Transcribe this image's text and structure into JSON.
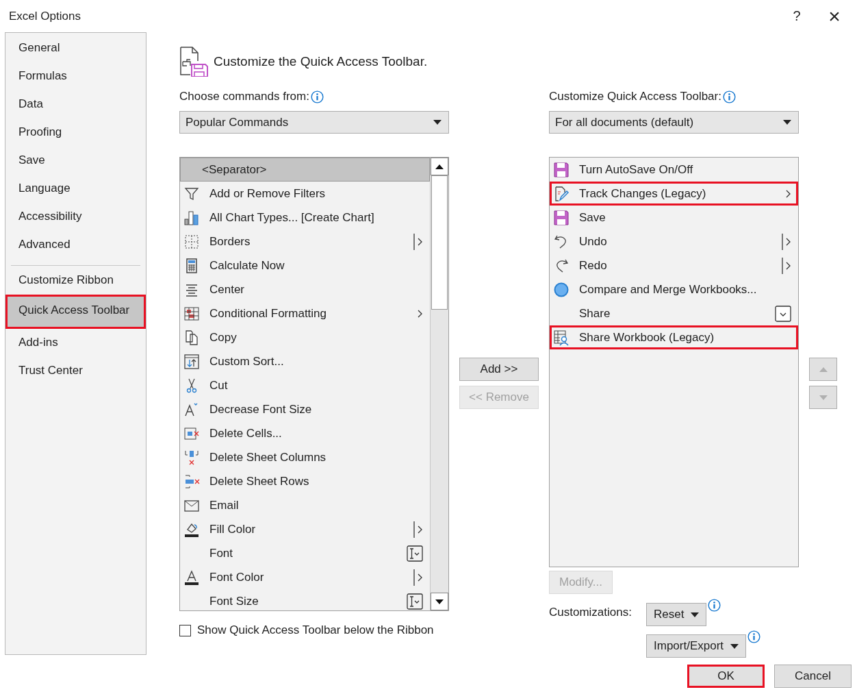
{
  "window": {
    "title": "Excel Options",
    "help": "?",
    "close": "×"
  },
  "sidebar": {
    "sections": [
      {
        "items": [
          {
            "label": "General",
            "selected": false,
            "highlighted": false
          },
          {
            "label": "Formulas",
            "selected": false,
            "highlighted": false
          },
          {
            "label": "Data",
            "selected": false,
            "highlighted": false
          },
          {
            "label": "Proofing",
            "selected": false,
            "highlighted": false
          },
          {
            "label": "Save",
            "selected": false,
            "highlighted": false
          },
          {
            "label": "Language",
            "selected": false,
            "highlighted": false
          },
          {
            "label": "Accessibility",
            "selected": false,
            "highlighted": false
          },
          {
            "label": "Advanced",
            "selected": false,
            "highlighted": false
          }
        ]
      },
      {
        "items": [
          {
            "label": "Customize Ribbon",
            "selected": false,
            "highlighted": false
          },
          {
            "label": "Quick Access Toolbar",
            "selected": true,
            "highlighted": true
          },
          {
            "label": "Add-ins",
            "selected": false,
            "highlighted": false
          },
          {
            "label": "Trust Center",
            "selected": false,
            "highlighted": false
          }
        ]
      }
    ]
  },
  "heading": "Customize the Quick Access Toolbar.",
  "commands_from": {
    "label": "Choose commands from:",
    "value": "Popular Commands"
  },
  "toolbar_for": {
    "label": "Customize Quick Access Toolbar:",
    "value": "For all documents (default)"
  },
  "commands": [
    {
      "label": "<Separator>",
      "selected": true,
      "kind": "plain"
    },
    {
      "label": "Add or Remove Filters",
      "selected": false,
      "kind": "plain"
    },
    {
      "label": "All Chart Types... [Create Chart]",
      "selected": false,
      "kind": "plain"
    },
    {
      "label": "Borders",
      "selected": false,
      "kind": "split"
    },
    {
      "label": "Calculate Now",
      "selected": false,
      "kind": "plain"
    },
    {
      "label": "Center",
      "selected": false,
      "kind": "plain"
    },
    {
      "label": "Conditional Formatting",
      "selected": false,
      "kind": "submenu"
    },
    {
      "label": "Copy",
      "selected": false,
      "kind": "plain"
    },
    {
      "label": "Custom Sort...",
      "selected": false,
      "kind": "plain"
    },
    {
      "label": "Cut",
      "selected": false,
      "kind": "plain"
    },
    {
      "label": "Decrease Font Size",
      "selected": false,
      "kind": "plain"
    },
    {
      "label": "Delete Cells...",
      "selected": false,
      "kind": "plain"
    },
    {
      "label": "Delete Sheet Columns",
      "selected": false,
      "kind": "plain"
    },
    {
      "label": "Delete Sheet Rows",
      "selected": false,
      "kind": "plain"
    },
    {
      "label": "Email",
      "selected": false,
      "kind": "plain"
    },
    {
      "label": "Fill Color",
      "selected": false,
      "kind": "split"
    },
    {
      "label": "Font",
      "selected": false,
      "kind": "field"
    },
    {
      "label": "Font Color",
      "selected": false,
      "kind": "split"
    },
    {
      "label": "Font Size",
      "selected": false,
      "kind": "field"
    }
  ],
  "add_button": {
    "label": "Add >>",
    "disabled": false
  },
  "remove_button": {
    "label": "<< Remove",
    "disabled": true
  },
  "toolbar_items": [
    {
      "label": "Turn AutoSave On/Off",
      "highlighted": false,
      "kind": "plain"
    },
    {
      "label": "Track Changes (Legacy)",
      "highlighted": true,
      "kind": "submenu"
    },
    {
      "label": "Save",
      "highlighted": false,
      "kind": "plain"
    },
    {
      "label": "Undo",
      "highlighted": false,
      "kind": "split"
    },
    {
      "label": "Redo",
      "highlighted": false,
      "kind": "split"
    },
    {
      "label": "Compare and Merge Workbooks...",
      "highlighted": false,
      "kind": "plain"
    },
    {
      "label": "Share",
      "highlighted": false,
      "kind": "dropdown"
    },
    {
      "label": "Share Workbook (Legacy)",
      "highlighted": true,
      "kind": "plain"
    }
  ],
  "move_up": {
    "disabled": true
  },
  "move_down": {
    "disabled": true
  },
  "modify_button": {
    "label": "Modify...",
    "disabled": true
  },
  "customizations": {
    "label": "Customizations:",
    "reset": "Reset",
    "import_export": "Import/Export"
  },
  "show_below_ribbon": {
    "label": "Show Quick Access Toolbar below the Ribbon",
    "checked": false
  },
  "ok_button": {
    "label": "OK",
    "highlighted": true
  },
  "cancel_button": {
    "label": "Cancel",
    "highlighted": false
  }
}
